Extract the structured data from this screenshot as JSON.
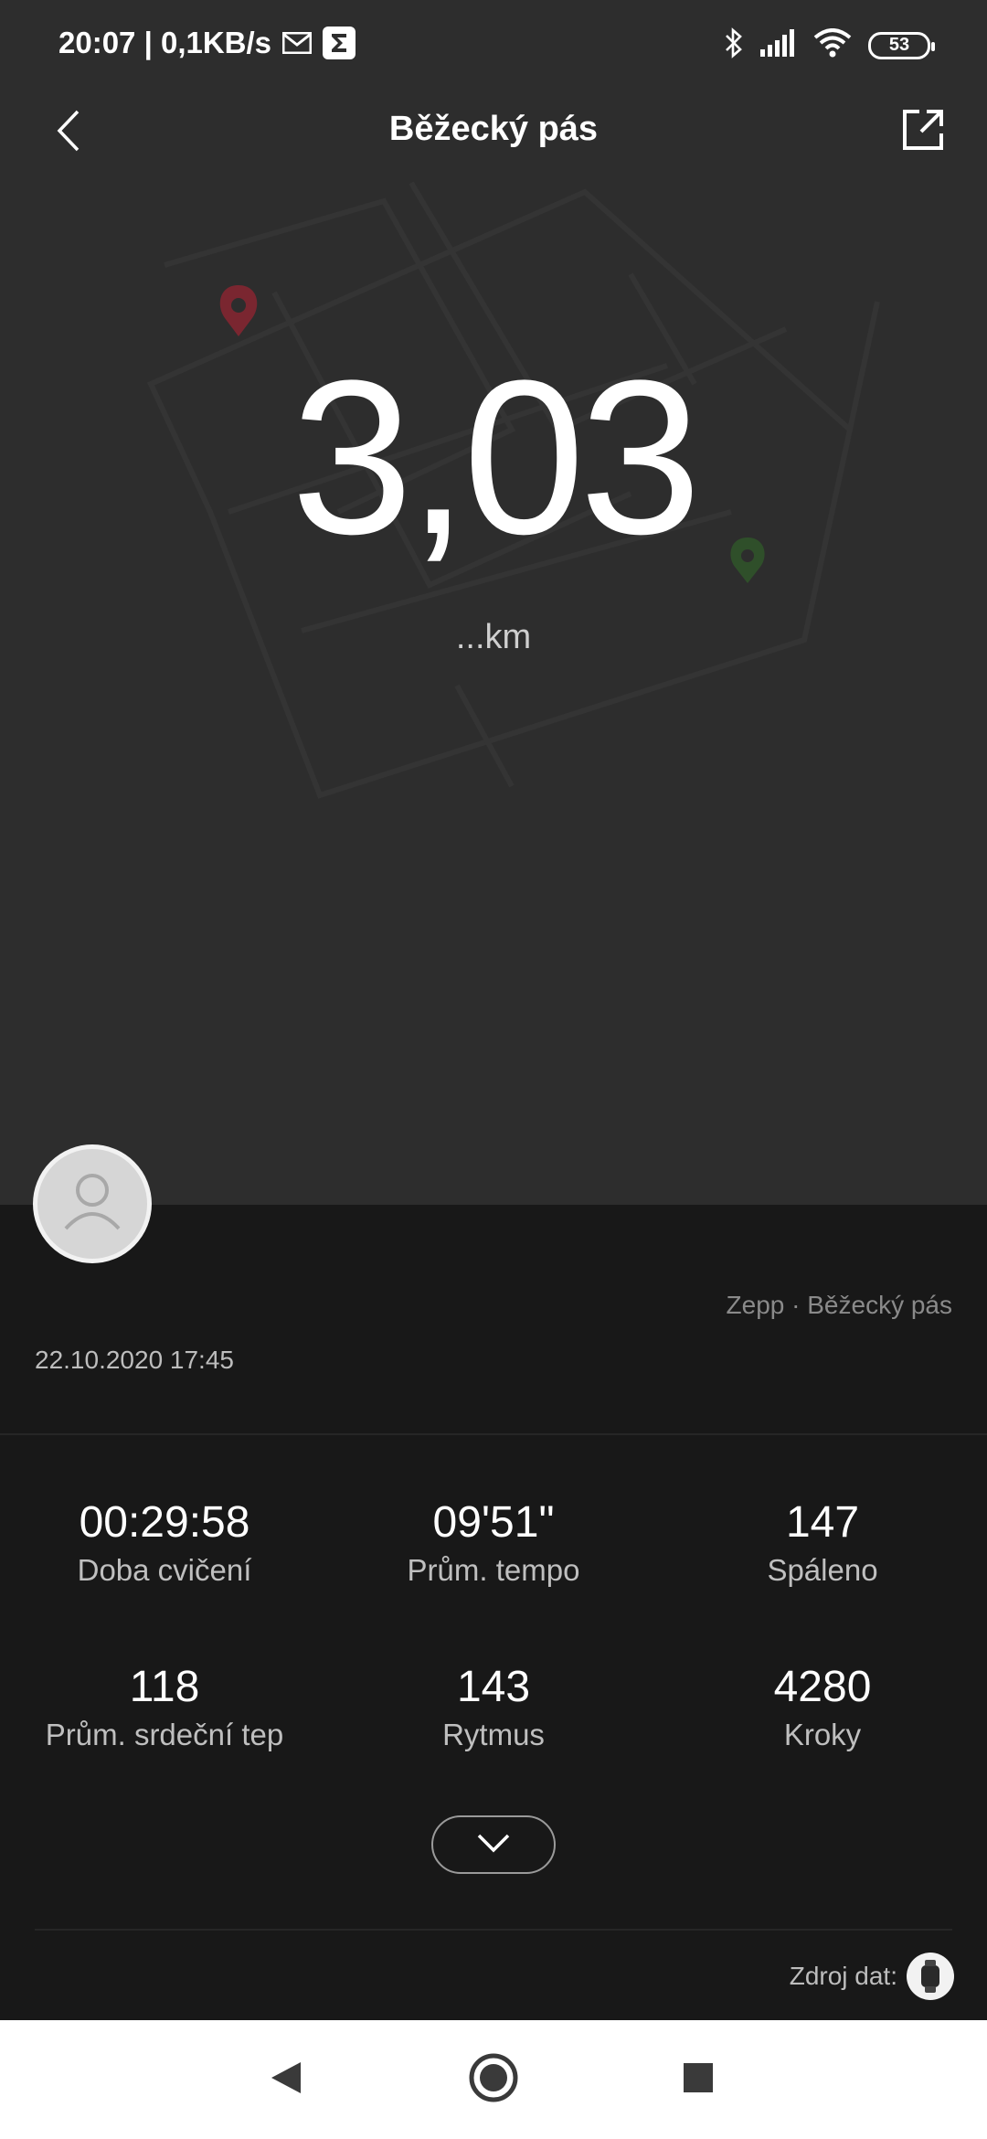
{
  "status_bar": {
    "time_speed": "20:07 | 0,1KB/s",
    "battery": "53"
  },
  "header": {
    "title": "Běžecký pás"
  },
  "summary": {
    "distance": "3,03",
    "unit": "...km"
  },
  "meta": {
    "source_app": "Zepp · Běžecký pás",
    "datetime": "22.10.2020 17:45"
  },
  "stats": [
    {
      "value": "00:29:58",
      "label": "Doba cvičení"
    },
    {
      "value": "09'51\"",
      "label": "Prům. tempo"
    },
    {
      "value": "147",
      "label": "Spáleno"
    },
    {
      "value": "118",
      "label": "Prům. srdeční tep"
    },
    {
      "value": "143",
      "label": "Rytmus"
    },
    {
      "value": "4280",
      "label": "Kroky"
    }
  ],
  "footer": {
    "data_source_label": "Zdroj dat:"
  },
  "icons": {
    "back": "chevron-left-icon",
    "share": "share-icon",
    "expand": "chevron-down-icon",
    "avatar": "user-icon",
    "device": "watch-icon"
  },
  "colors": {
    "hero_bg": "#2d2d2d",
    "details_bg": "#181818",
    "start_pin": "#7a2630",
    "end_pin": "#2f4f2a"
  }
}
